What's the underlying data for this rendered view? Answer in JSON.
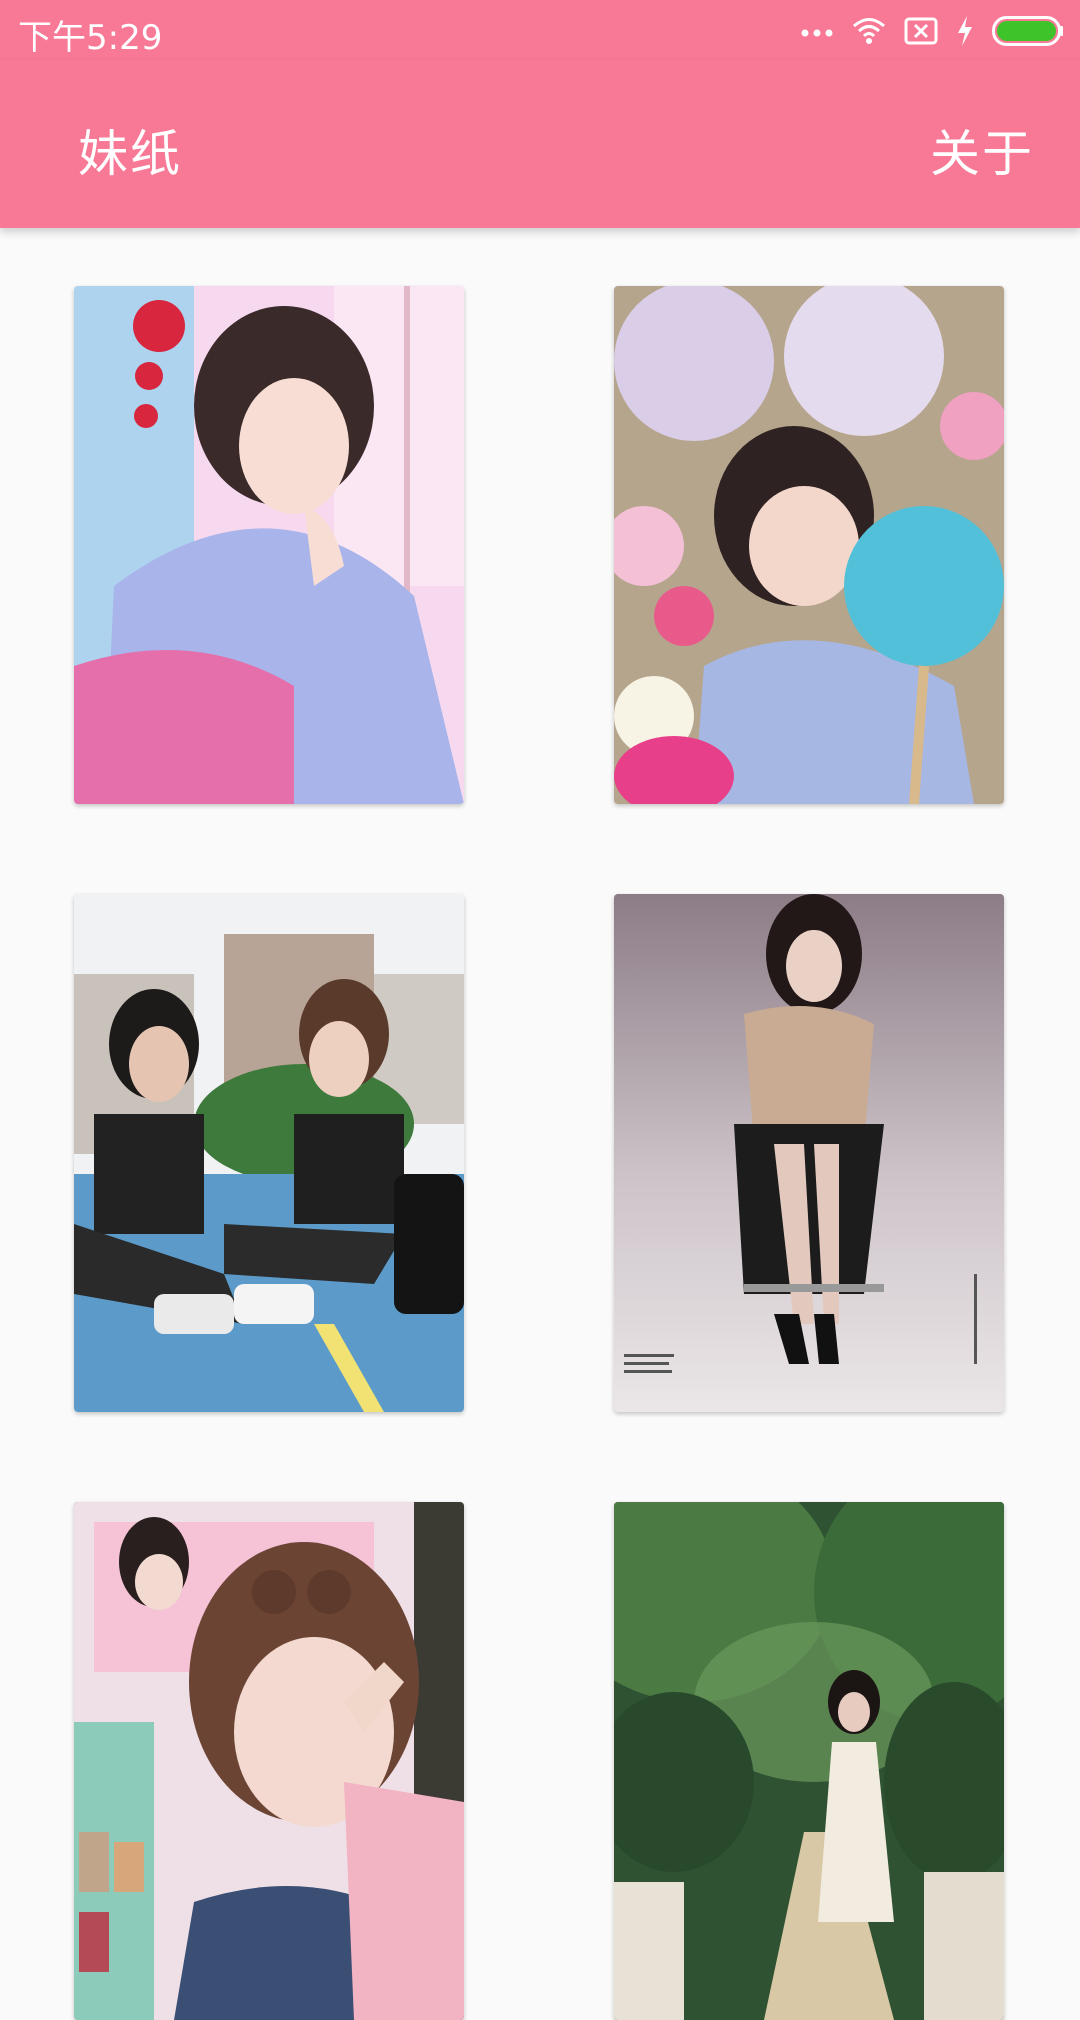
{
  "status_bar": {
    "time": "下午5:29",
    "icons": [
      "more-dots-icon",
      "wifi-icon",
      "no-sim-icon",
      "charging-bolt-icon",
      "battery-icon"
    ],
    "battery_color": "#3fc32a"
  },
  "app_bar": {
    "title": "妹纸",
    "about_label": "关于",
    "color": "#f87996"
  },
  "gallery": {
    "items": [
      {
        "alt": "girl-in-blue-yukata-pink-sash"
      },
      {
        "alt": "girl-with-paper-lanterns-and-fan"
      },
      {
        "alt": "two-girls-sitting-on-basketball-court"
      },
      {
        "alt": "girl-seated-on-stool-magazine-page"
      },
      {
        "alt": "girl-making-peace-sign-with-poster"
      },
      {
        "alt": "girl-in-white-dress-in-forest"
      }
    ]
  }
}
